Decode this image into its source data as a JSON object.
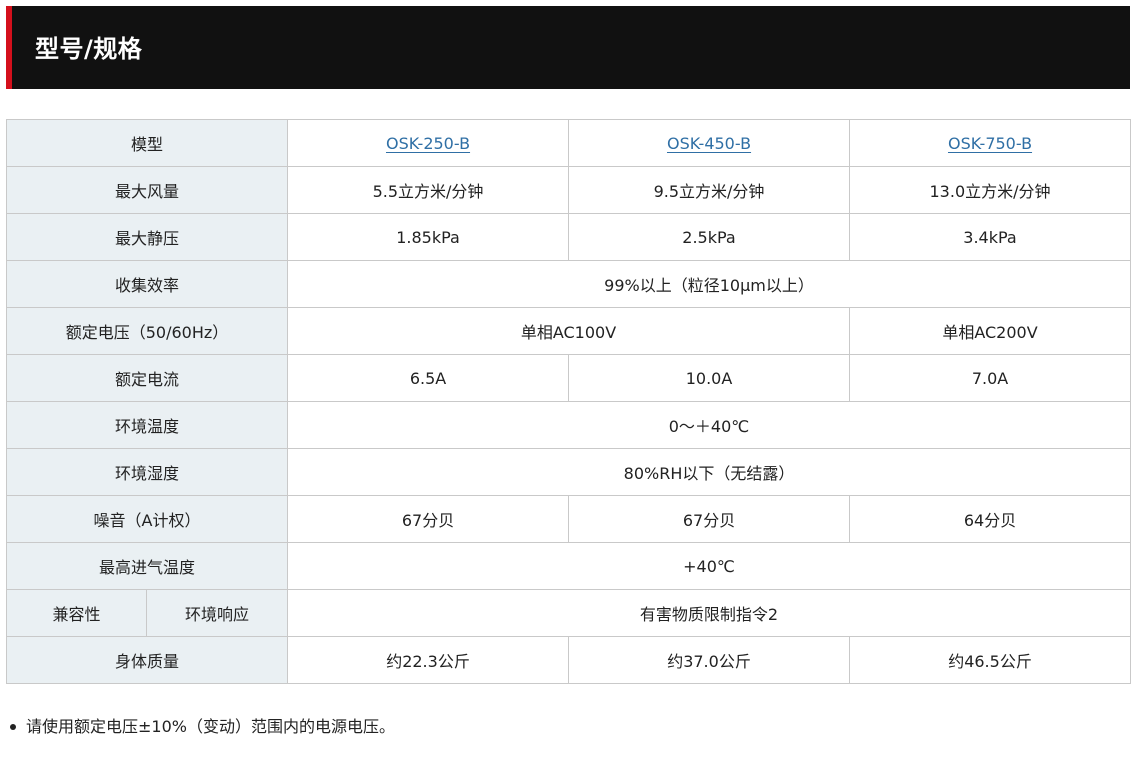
{
  "header": {
    "title": "型号/规格"
  },
  "table": {
    "model_label": "模型",
    "models": [
      "OSK-250-B",
      "OSK-450-B",
      "OSK-750-B"
    ],
    "rows": {
      "max_airflow": {
        "label": "最大风量",
        "values": [
          "5.5立方米/分钟",
          "9.5立方米/分钟",
          "13.0立方米/分钟"
        ]
      },
      "max_static_pressure": {
        "label": "最大静压",
        "values": [
          "1.85kPa",
          "2.5kPa",
          "3.4kPa"
        ]
      },
      "collection_efficiency": {
        "label": "收集效率",
        "value": "99%以上（粒径10μm以上）"
      },
      "rated_voltage": {
        "label": "额定电压（50/60Hz）",
        "values": [
          "单相AC100V",
          "单相AC200V"
        ]
      },
      "rated_current": {
        "label": "额定电流",
        "values": [
          "6.5A",
          "10.0A",
          "7.0A"
        ]
      },
      "ambient_temperature": {
        "label": "环境温度",
        "value": "0～＋40℃"
      },
      "ambient_humidity": {
        "label": "环境湿度",
        "value": "80%RH以下（无结露）"
      },
      "noise": {
        "label": "噪音（A计权）",
        "values": [
          "67分贝",
          "67分贝",
          "64分贝"
        ]
      },
      "max_intake_temperature": {
        "label": "最高进气温度",
        "value": "+40℃"
      },
      "compatibility": {
        "label": "兼容性",
        "sublabel": "环境响应",
        "value": "有害物质限制指令2"
      },
      "body_mass": {
        "label": "身体质量",
        "values": [
          "约22.3公斤",
          "约37.0公斤",
          "约46.5公斤"
        ]
      }
    }
  },
  "notes": [
    "请使用额定电压±10%（变动）范围内的电源电压。"
  ]
}
